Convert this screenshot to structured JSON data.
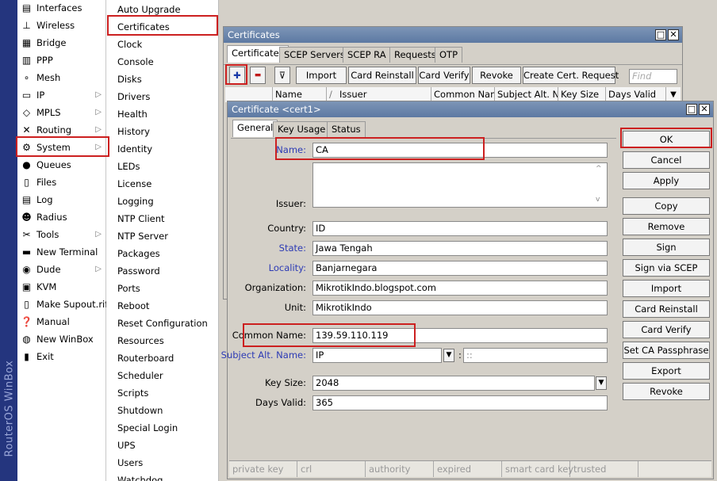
{
  "app": {
    "vertical_label": "RouterOS WinBox"
  },
  "menu": [
    {
      "label": "Interfaces",
      "icon": "interfaces-icon",
      "glyph": "▤"
    },
    {
      "label": "Wireless",
      "icon": "wireless-icon",
      "glyph": "⊥"
    },
    {
      "label": "Bridge",
      "icon": "bridge-icon",
      "glyph": "▦"
    },
    {
      "label": "PPP",
      "icon": "ppp-icon",
      "glyph": "▥"
    },
    {
      "label": "Mesh",
      "icon": "mesh-icon",
      "glyph": "∘"
    },
    {
      "label": "IP",
      "icon": "ip-icon",
      "glyph": "▭",
      "arrow": "▷"
    },
    {
      "label": "MPLS",
      "icon": "mpls-icon",
      "glyph": "◇",
      "arrow": "▷"
    },
    {
      "label": "Routing",
      "icon": "routing-icon",
      "glyph": "✕",
      "arrow": "▷"
    },
    {
      "label": "System",
      "icon": "system-icon",
      "glyph": "⚙",
      "arrow": "▷"
    },
    {
      "label": "Queues",
      "icon": "queues-icon",
      "glyph": "●"
    },
    {
      "label": "Files",
      "icon": "files-icon",
      "glyph": "▯"
    },
    {
      "label": "Log",
      "icon": "log-icon",
      "glyph": "▤"
    },
    {
      "label": "Radius",
      "icon": "radius-icon",
      "glyph": "☻"
    },
    {
      "label": "Tools",
      "icon": "tools-icon",
      "glyph": "✂",
      "arrow": "▷"
    },
    {
      "label": "New Terminal",
      "icon": "terminal-icon",
      "glyph": "▬"
    },
    {
      "label": "Dude",
      "icon": "dude-icon",
      "glyph": "◉",
      "arrow": "▷"
    },
    {
      "label": "KVM",
      "icon": "kvm-icon",
      "glyph": "▣"
    },
    {
      "label": "Make Supout.rif",
      "icon": "supout-icon",
      "glyph": "▯"
    },
    {
      "label": "Manual",
      "icon": "manual-icon",
      "glyph": "❓"
    },
    {
      "label": "New WinBox",
      "icon": "winbox-icon",
      "glyph": "◍"
    },
    {
      "label": "Exit",
      "icon": "exit-icon",
      "glyph": "▮"
    }
  ],
  "submenu": [
    "Auto Upgrade",
    "Certificates",
    "Clock",
    "Console",
    "Disks",
    "Drivers",
    "Health",
    "History",
    "Identity",
    "LEDs",
    "License",
    "Logging",
    "NTP Client",
    "NTP Server",
    "Packages",
    "Password",
    "Ports",
    "Reboot",
    "Reset Configuration",
    "Resources",
    "Routerboard",
    "Scheduler",
    "Scripts",
    "Shutdown",
    "Special Login",
    "UPS",
    "Users",
    "Watchdog"
  ],
  "certs_window": {
    "title": "Certificates",
    "tabs": [
      "Certificates",
      "SCEP Servers",
      "SCEP RA",
      "Requests",
      "OTP"
    ],
    "toolbar": {
      "add": "✚",
      "remove": "▬",
      "filter": "⊽",
      "import": "Import",
      "card_reinstall": "Card Reinstall",
      "card_verify": "Card Verify",
      "revoke": "Revoke",
      "create_request": "Create Cert. Request",
      "find_placeholder": "Find"
    },
    "columns": [
      "",
      "Name",
      "/",
      "Issuer",
      "Common Name",
      "Subject Alt. N...",
      "Key Size",
      "Days Valid"
    ]
  },
  "cert_dialog": {
    "title": "Certificate <cert1>",
    "tabs": [
      "General",
      "Key Usage",
      "Status"
    ],
    "fields": {
      "name": {
        "label": "Name:",
        "value": "CA"
      },
      "issuer": {
        "label": "Issuer:",
        "value": ""
      },
      "country": {
        "label": "Country:",
        "value": "ID"
      },
      "state": {
        "label": "State:",
        "value": "Jawa Tengah"
      },
      "locality": {
        "label": "Locality:",
        "value": "Banjarnegara"
      },
      "organization": {
        "label": "Organization:",
        "value": "MikrotikIndo.blogspot.com"
      },
      "unit": {
        "label": "Unit:",
        "value": "MikrotikIndo"
      },
      "common_name": {
        "label": "Common Name:",
        "value": "139.59.110.119"
      },
      "subject_alt_name": {
        "label": "Subject Alt. Name:",
        "value": "IP",
        "sep": ":",
        "value2": "::"
      },
      "key_size": {
        "label": "Key Size:",
        "value": "2048"
      },
      "days_valid": {
        "label": "Days Valid:",
        "value": "365"
      }
    },
    "buttons": [
      "OK",
      "Cancel",
      "Apply",
      "Copy",
      "Remove",
      "Sign",
      "Sign via SCEP",
      "Import",
      "Card Reinstall",
      "Card Verify",
      "Set CA Passphrase",
      "Export",
      "Revoke"
    ],
    "status_bar": [
      "private key",
      "crl",
      "authority",
      "expired",
      "smart card key",
      "trusted"
    ]
  },
  "colors": {
    "highlight": "#cc2020",
    "title_bar": "#6a84ab",
    "sidebar": "#24357e",
    "blue_label": "#2d3bb5"
  }
}
